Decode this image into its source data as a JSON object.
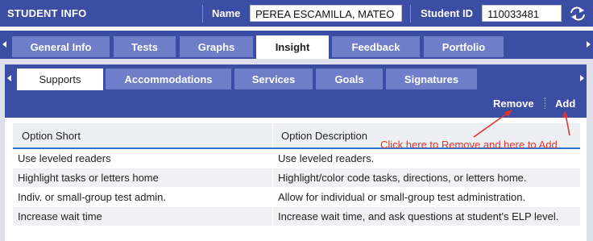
{
  "header": {
    "app_title": "STUDENT INFO",
    "name_label": "Name",
    "name_value": "PEREA  ESCAMILLA, MATEO",
    "student_id_label": "Student ID",
    "student_id_value": "110033481",
    "swap_icon": "swap-arrows-icon"
  },
  "main_tabs": [
    {
      "label": "General Info",
      "active": false
    },
    {
      "label": "Tests",
      "active": false
    },
    {
      "label": "Graphs",
      "active": false
    },
    {
      "label": "Insight",
      "active": true
    },
    {
      "label": "Feedback",
      "active": false
    },
    {
      "label": "Portfolio",
      "active": false
    }
  ],
  "sub_tabs": [
    {
      "label": "Supports",
      "active": true
    },
    {
      "label": "Accommodations",
      "active": false
    },
    {
      "label": "Services",
      "active": false
    },
    {
      "label": "Goals",
      "active": false
    },
    {
      "label": "Signatures",
      "active": false
    }
  ],
  "actions": {
    "remove_label": "Remove",
    "add_label": "Add"
  },
  "table": {
    "columns": [
      "Option Short",
      "Option Description"
    ],
    "rows": [
      [
        "Use leveled readers",
        "Use leveled readers."
      ],
      [
        "Highlight tasks or letters home",
        "Highlight/color code tasks, directions, or letters home."
      ],
      [
        "Indiv. or small-group test admin.",
        "Allow for individual or small-group test administration."
      ],
      [
        "Increase wait time",
        "Increase wait time, and ask questions at student's ELP level."
      ]
    ]
  },
  "annotation": {
    "text": "Click here to Remove and here to Add",
    "color": "#e1342e"
  },
  "colors": {
    "band": "#3c4ea4",
    "tab_inactive": "#6e7ec8",
    "header_underline": "#2a74d1"
  }
}
